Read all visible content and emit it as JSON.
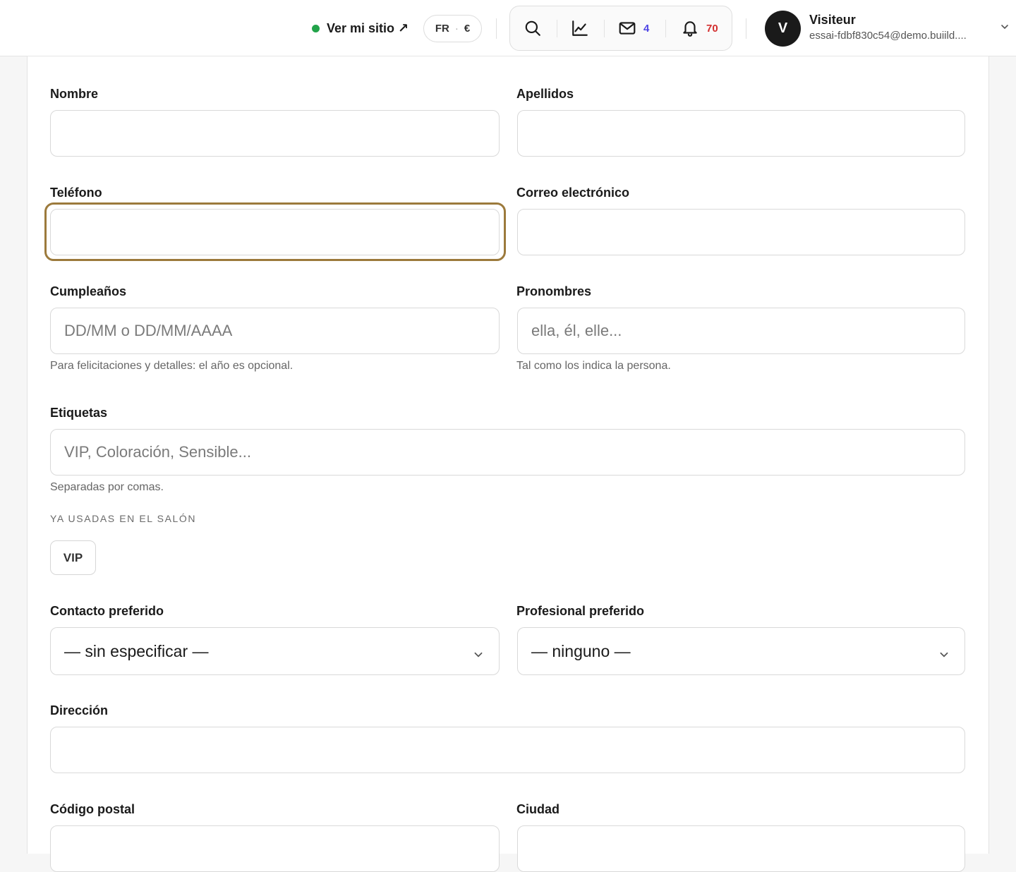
{
  "header": {
    "site_link": "Ver mi sitio ↗",
    "lang": "FR",
    "currency": "€",
    "messages_count": "4",
    "notifications_count": "70",
    "user": {
      "initial": "V",
      "name": "Visiteur",
      "email": "essai-fdbf830c54@demo.buiild...."
    }
  },
  "icons": {
    "search": "search-icon",
    "stats": "chart-line-icon",
    "messages": "mail-icon",
    "notifications": "bell-icon",
    "user_menu": "chevron-down-icon"
  },
  "colors": {
    "online": "#22a34a",
    "messages_count": "#4f46e5",
    "notifications_count": "#d32f2f",
    "focus_ring": "#9c7a3c"
  },
  "form": {
    "nombre": {
      "label": "Nombre",
      "value": ""
    },
    "apellidos": {
      "label": "Apellidos",
      "value": ""
    },
    "telefono": {
      "label": "Teléfono",
      "value": ""
    },
    "correo": {
      "label": "Correo electrónico",
      "value": ""
    },
    "cumpleanos": {
      "label": "Cumpleaños",
      "placeholder": "DD/MM o DD/MM/AAAA",
      "hint": "Para felicitaciones y detalles: el año es opcional."
    },
    "pronombres": {
      "label": "Pronombres",
      "placeholder": "ella, él, elle...",
      "hint": "Tal como los indica la persona."
    },
    "etiquetas": {
      "label": "Etiquetas",
      "placeholder": "VIP, Coloración, Sensible...",
      "hint": "Separadas por comas."
    },
    "used_tags_title": "YA USADAS EN EL SALÓN",
    "used_tags": [
      "VIP"
    ],
    "contacto": {
      "label": "Contacto preferido",
      "selected": "— sin especificar —"
    },
    "profesional": {
      "label": "Profesional preferido",
      "selected": "— ninguno —"
    },
    "direccion": {
      "label": "Dirección",
      "value": ""
    },
    "codigo_postal": {
      "label": "Código postal",
      "value": ""
    },
    "ciudad": {
      "label": "Ciudad",
      "value": ""
    }
  }
}
